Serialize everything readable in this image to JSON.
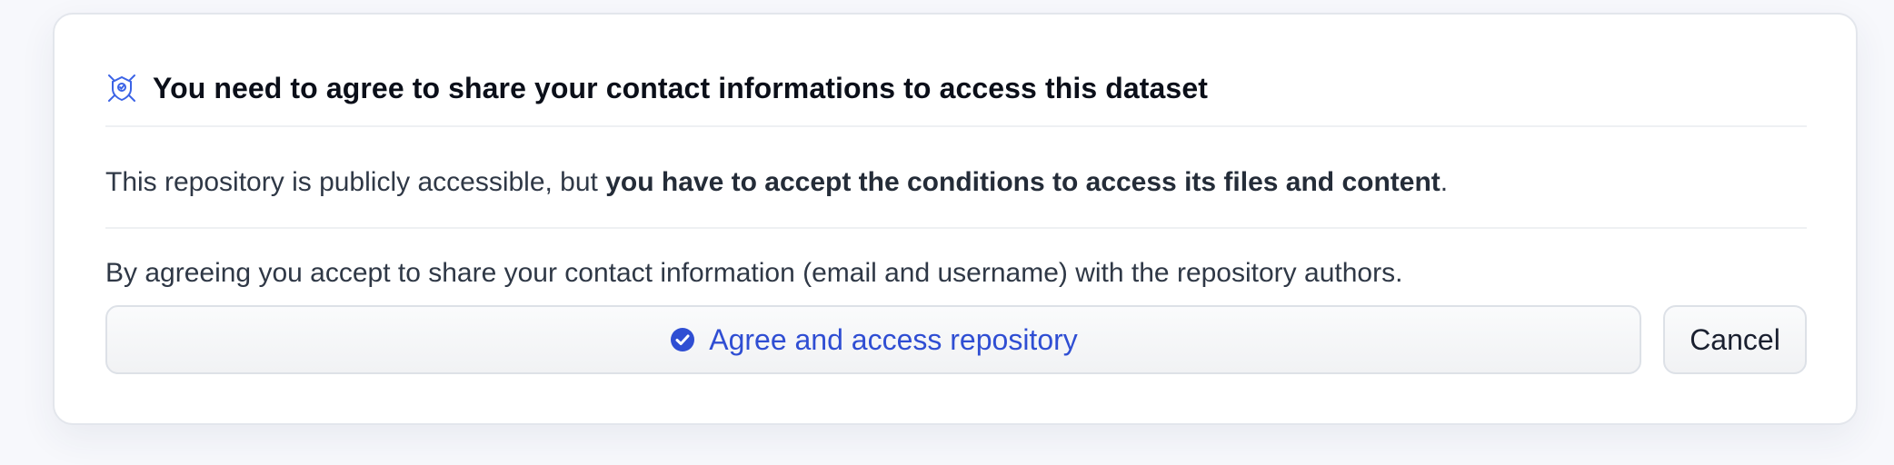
{
  "gate": {
    "icon": "gated-repo-icon",
    "title": "You need to agree to share your contact informations to access this dataset",
    "notice_prefix": "This repository is publicly accessible, but ",
    "notice_bold": "you have to accept the conditions to access its files and content",
    "notice_suffix": ".",
    "agreement_text": "By agreeing you accept to share your contact information (email and username) with the repository authors."
  },
  "actions": {
    "agree_icon": "check-circle-icon",
    "agree_label": "Agree and access repository",
    "cancel_label": "Cancel"
  },
  "colors": {
    "accent": "#2f4ed3",
    "icon_blue": "#3b63e6",
    "title": "#0b0f19",
    "body_text": "#2f3846"
  }
}
